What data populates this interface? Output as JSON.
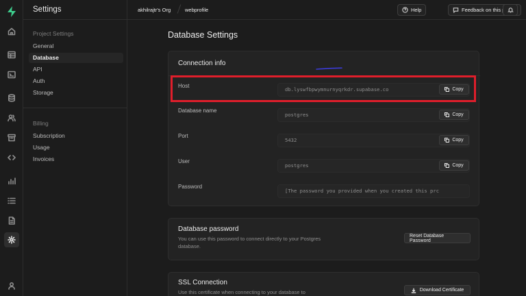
{
  "rail": {
    "icons": [
      "logo",
      "home-icon",
      "table-editor-icon",
      "sql-editor-icon",
      "database-icon",
      "auth-icon",
      "storage-icon",
      "edge-functions-icon",
      "reports-icon",
      "logs-icon",
      "api-docs-icon",
      "settings-icon",
      "user-icon"
    ]
  },
  "sidebar": {
    "title": "Settings",
    "project_section": "Project Settings",
    "project_items": [
      "General",
      "Database",
      "API",
      "Auth",
      "Storage"
    ],
    "billing_section": "Billing",
    "billing_items": [
      "Subscription",
      "Usage",
      "Invoices"
    ]
  },
  "topbar": {
    "org": "akhilrajtr's Org",
    "project": "webprofile",
    "help_label": "Help",
    "feedback_label": "Feedback on this page?"
  },
  "main": {
    "page_title": "Database Settings",
    "connection": {
      "title": "Connection info",
      "copy_label": "Copy",
      "rows": [
        {
          "label": "Host",
          "value": "db.lyswfbpwymnurnyqrkdr.supabase.co"
        },
        {
          "label": "Database name",
          "value": "postgres"
        },
        {
          "label": "Port",
          "value": "5432"
        },
        {
          "label": "User",
          "value": "postgres"
        },
        {
          "label": "Password",
          "value": "[The password you provided when you created this prc"
        }
      ]
    },
    "password": {
      "title": "Database password",
      "description": "You can use this password to connect directly to your Postgres database.",
      "button": "Reset Database Password"
    },
    "ssl": {
      "title": "SSL Connection",
      "description": "Use this certificate when connecting to your database to",
      "button": "Download Certificate"
    }
  },
  "colors": {
    "background": "#1c1c1c",
    "card": "#232323",
    "brand": "#3ecf8e",
    "annotation_red": "#e01e2b",
    "annotation_blue": "#3b3bd6"
  }
}
